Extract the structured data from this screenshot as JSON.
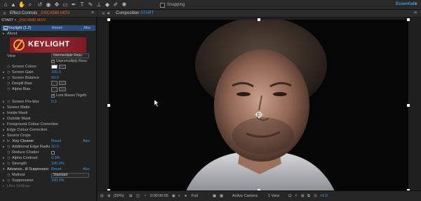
{
  "toolbar": {
    "snapping_label": "Snapping",
    "workspace": "Essentials",
    "more": "»"
  },
  "effect_controls": {
    "tab_prefix": "Effect Controls",
    "tab_file": "_DSC4986.MOV",
    "subtitle_prefix": "START • ",
    "subtitle_file": "_DSC4986.MOV",
    "effect_name": "Keylight (1.2)",
    "reset": "Reset",
    "about_short": "Abo",
    "about_row": "About",
    "logo_text": "KEYLIGHT",
    "params": {
      "view_label": "View",
      "view_value": "Intermediate Resu",
      "unpremultiply_label": "Unpremultiply Resu",
      "screen_colour_label": "Screen Colour",
      "screen_gain_label": "Screen Gain",
      "screen_gain_value": "100.0",
      "screen_balance_label": "Screen Balance",
      "screen_balance_value": "50.0",
      "despill_bias_label": "Despill Bias",
      "alpha_bias_label": "Alpha Bias",
      "lock_biases_label": "Lock Biases Togeth",
      "screen_preblur_label": "Screen Pre-blur",
      "screen_preblur_value": "0.0",
      "screen_matte": "Screen Matte",
      "inside_mask": "Inside Mask",
      "outside_mask": "Outside Mask",
      "fg_colour_correction": "Foreground Colour Correction",
      "edge_colour_correction": "Edge Colour Correction",
      "source_crops": "Source Crops"
    },
    "key_cleaner": {
      "name": "Key Cleaner",
      "reset": "Reset",
      "about": "Abo",
      "additional_edge_radius_label": "Additional Edge Radiu",
      "additional_edge_radius_value": "10.0",
      "reduce_chatter_label": "Reduce Chatter",
      "alpha_contrast_label": "Alpha Contrast",
      "alpha_contrast_value": "0.0%",
      "strength_label": "Strength",
      "strength_value": "100.0%"
    },
    "suppressor": {
      "name": "Advance...ill Suppressor",
      "reset": "Reset",
      "about": "Abo",
      "method_label": "Method",
      "method_value": "Standard",
      "suppression_label": "Suppression",
      "suppression_value": "100.0%",
      "ultra_settings": "Ultra Settings"
    }
  },
  "composition": {
    "tab_prefix": "Composition",
    "tab_name": "START",
    "footer": {
      "zoom": "(50%)",
      "timecode": "0:00:00:05",
      "resolution": "Full",
      "camera": "Active Camera",
      "views": "1 View",
      "exposure": "+0.0"
    }
  },
  "colors": {
    "accent_blue": "#3d9be8",
    "accent_orange": "#e0622a",
    "effect_header": "#2b4a78",
    "keylight_red": "#962531"
  }
}
